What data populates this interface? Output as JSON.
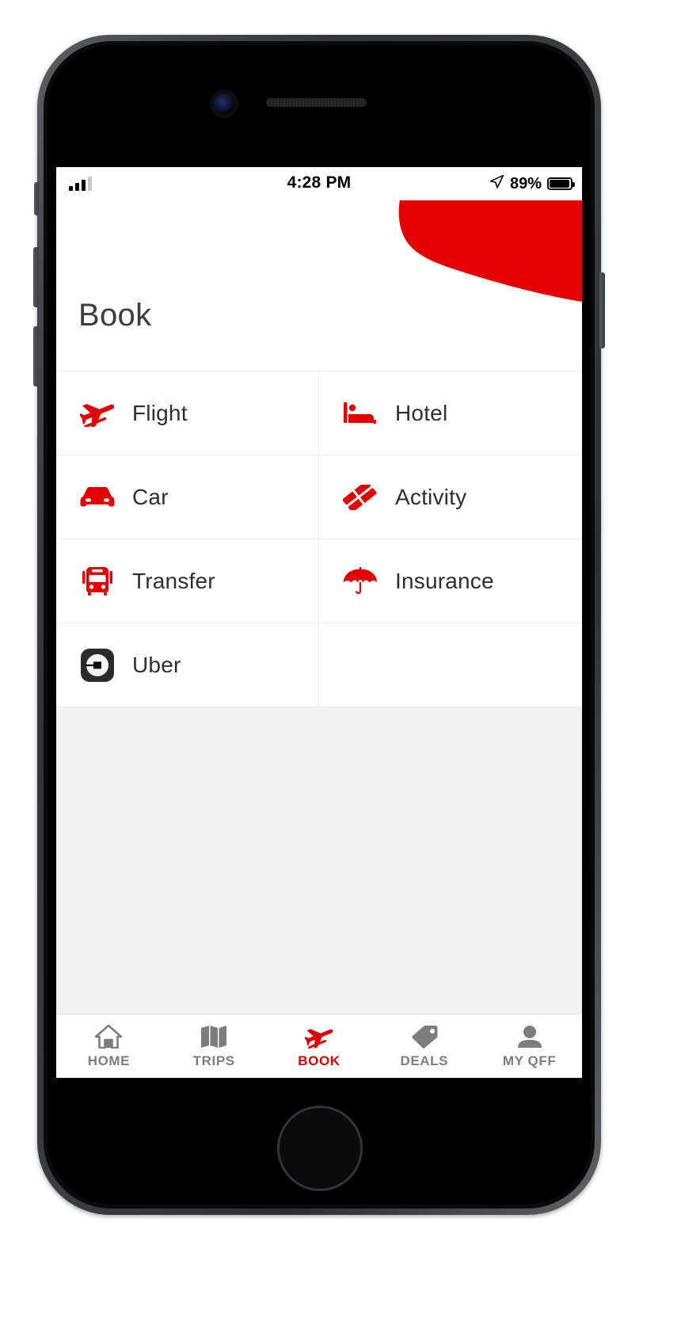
{
  "colors": {
    "brand_red": "#e40000",
    "accent_red": "#e00000",
    "title_gray": "#3d3d3d",
    "label_gray": "#2e2e2e",
    "tab_inactive": "#7d7d7d",
    "screen_bg": "#f2f2f2",
    "divider": "#ececec"
  },
  "status_bar": {
    "signal_icon": "signal-bars-icon",
    "time": "4:28 PM",
    "location_icon": "location-arrow-icon",
    "battery_percent": "89%",
    "battery_icon": "battery-icon"
  },
  "header": {
    "title": "Book",
    "swoosh_icon": "red-swoosh-shape"
  },
  "menu": {
    "rows": [
      [
        {
          "label": "Flight",
          "icon": "plane-icon",
          "name": "menu-item-flight"
        },
        {
          "label": "Hotel",
          "icon": "bed-icon",
          "name": "menu-item-hotel"
        }
      ],
      [
        {
          "label": "Car",
          "icon": "car-icon",
          "name": "menu-item-car"
        },
        {
          "label": "Activity",
          "icon": "tickets-icon",
          "name": "menu-item-activity"
        }
      ],
      [
        {
          "label": "Transfer",
          "icon": "bus-icon",
          "name": "menu-item-transfer"
        },
        {
          "label": "Insurance",
          "icon": "umbrella-icon",
          "name": "menu-item-insurance"
        }
      ],
      [
        {
          "label": "Uber",
          "icon": "uber-logo-icon",
          "name": "menu-item-uber"
        },
        {
          "label": "",
          "icon": "",
          "name": "menu-item-empty"
        }
      ]
    ]
  },
  "tab_bar": {
    "items": [
      {
        "label": "HOME",
        "icon": "home-icon",
        "active": false
      },
      {
        "label": "TRIPS",
        "icon": "map-icon",
        "active": false
      },
      {
        "label": "BOOK",
        "icon": "plane-icon",
        "active": true
      },
      {
        "label": "DEALS",
        "icon": "tag-icon",
        "active": false
      },
      {
        "label": "MY QFF",
        "icon": "person-icon",
        "active": false
      }
    ]
  }
}
